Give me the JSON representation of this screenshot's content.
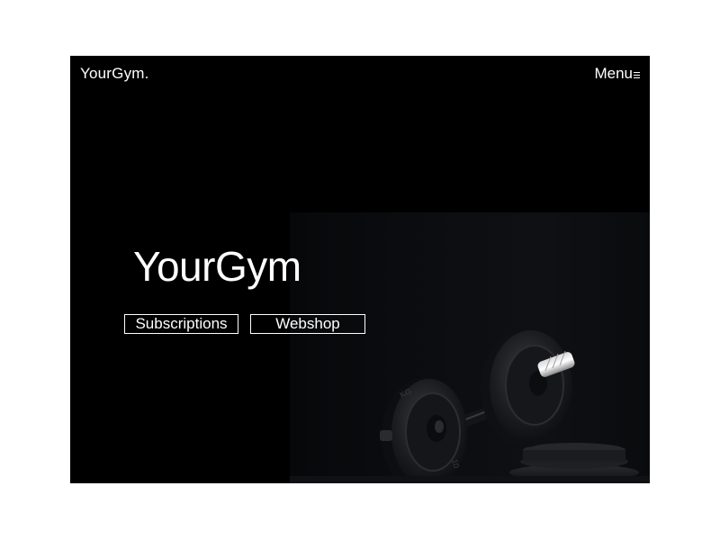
{
  "header": {
    "logo": "YourGym.",
    "menu_label": "Menu"
  },
  "hero": {
    "title": "YourGym",
    "buttons": {
      "subscriptions": "Subscriptions",
      "webshop": "Webshop"
    }
  },
  "icons": {
    "menu": "hamburger-icon"
  },
  "colors": {
    "background": "#000000",
    "text": "#ffffff",
    "page": "#ffffff"
  }
}
